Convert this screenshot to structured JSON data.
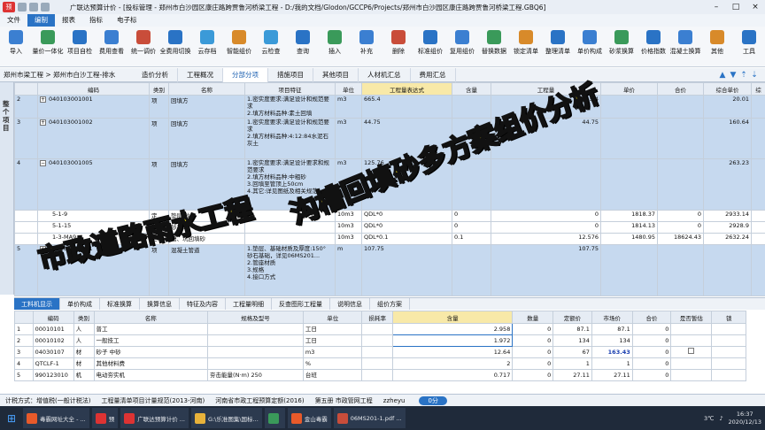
{
  "window": {
    "title": "广联达预算计价 - [投标管理 - 郑州市白沙园区康庄路跨贾鲁河桥梁工程 - D:/我的文档/Glodon/GCCP6/Projects/郑州市白沙园区康庄路跨贾鲁河桥梁工程.GBQ6]",
    "logo_text": "预"
  },
  "menu": [
    "文件",
    "编制",
    "报表",
    "指标",
    "电子标"
  ],
  "toolbar": [
    {
      "label": "导入",
      "color": "#3b7fd1"
    },
    {
      "label": "量价一体化",
      "color": "#3a9a5a"
    },
    {
      "label": "项目自检",
      "color": "#2a73c5"
    },
    {
      "label": "费用查看",
      "color": "#3b7fd1"
    },
    {
      "label": "统一调价",
      "color": "#c94d3a"
    },
    {
      "label": "全费用切换",
      "color": "#2a73c5"
    },
    {
      "label": "云存档",
      "color": "#3b9ad8"
    },
    {
      "label": "智能组价",
      "color": "#d88a2a"
    },
    {
      "label": "云检查",
      "color": "#3b9ad8"
    },
    {
      "label": "查询",
      "color": "#2a73c5"
    },
    {
      "label": "插入",
      "color": "#3a9a5a"
    },
    {
      "label": "补充",
      "color": "#3b7fd1"
    },
    {
      "label": "删除",
      "color": "#c94d3a"
    },
    {
      "label": "标准组价",
      "color": "#2a73c5"
    },
    {
      "label": "复用组价",
      "color": "#3b7fd1"
    },
    {
      "label": "替换数据",
      "color": "#3a9a5a"
    },
    {
      "label": "锁定清单",
      "color": "#d88a2a"
    },
    {
      "label": "整理清单",
      "color": "#2a73c5"
    },
    {
      "label": "单价构成",
      "color": "#3b7fd1"
    },
    {
      "label": "砂浆换算",
      "color": "#3a9a5a"
    },
    {
      "label": "价格指数",
      "color": "#2a73c5"
    },
    {
      "label": "混凝土换算",
      "color": "#3b7fd1"
    },
    {
      "label": "其他",
      "color": "#d88a2a"
    },
    {
      "label": "工具",
      "color": "#2a73c5"
    }
  ],
  "nav": {
    "breadcrumb": "郑州市梁工程 > 郑州市白沙工程-排水",
    "tabs": [
      "造价分析",
      "工程概况",
      "分部分项",
      "措施项目",
      "其他项目",
      "人材机汇总",
      "费用汇总"
    ],
    "selected": 2
  },
  "sidebar": {
    "label": "整个项目"
  },
  "upper": {
    "headers": [
      "编码",
      "类别",
      "名称",
      "项目特征",
      "单位",
      "工程量表达式",
      "含量",
      "工程量",
      "单价",
      "合价",
      "综合单价",
      "综"
    ],
    "rows": [
      {
        "no": "2",
        "code": "040103001001",
        "type": "项",
        "name": "回填方",
        "feature": "1.密实度要求:满足设计和规范要求\n2.填方材料品种:素土回填",
        "unit": "m3",
        "expr": "665.4",
        "content": "",
        "qty": "665.4",
        "price": "",
        "total": "",
        "unit_total": "20.01"
      },
      {
        "no": "3",
        "code": "040103001002",
        "type": "项",
        "name": "回填方",
        "feature": "1.密实度要求:满足设计和规范要求\n2.填方材料品种:4:12:84水泥石灰土",
        "unit": "m3",
        "expr": "44.75",
        "content": "",
        "qty": "44.75",
        "price": "",
        "total": "",
        "unit_total": "160.64"
      },
      {
        "no": "4",
        "code": "040103001005",
        "type": "项",
        "name": "回填方",
        "feature": "1.密实度要求:满足设计要求和规范要求\n2.填方材料品种:中粗砂\n3.回填至管顶上50cm\n4.其它:详见图纸及相关规范",
        "unit": "m3",
        "expr": "125.76",
        "content": "",
        "qty": "",
        "price": "",
        "total": "",
        "unit_total": "263.23"
      },
      {
        "no": "",
        "code": "5-1-9",
        "type": "定",
        "name": "垫层 砂",
        "feature": "",
        "unit": "10m3",
        "expr": "QDL*0",
        "content": "0",
        "qty": "0",
        "price": "1818.37",
        "total": "0",
        "unit_total": "2933.14"
      },
      {
        "no": "",
        "code": "5-1-15",
        "type": "定",
        "name": "砂基础",
        "feature": "",
        "unit": "10m3",
        "expr": "QDL*0",
        "content": "0",
        "qty": "0",
        "price": "1814.13",
        "total": "0",
        "unit_total": "2928.9"
      },
      {
        "no": "",
        "code": "1-3-MA9",
        "type": "定",
        "name": "槽、坑回填砂",
        "feature": "",
        "unit": "10m3",
        "expr": "QDL*0.1",
        "content": "0.1",
        "qty": "12.576",
        "price": "1480.95",
        "total": "18624.43",
        "unit_total": "2632.24"
      },
      {
        "no": "5",
        "code": "040501001001",
        "type": "项",
        "name": "混凝土管道",
        "feature": "1.垫层、基础材质及厚度:150° 砂石基础，详见06MS201...\n2.管座材质\n3.规格\n4.接口方式",
        "unit": "m",
        "expr": "107.75",
        "content": "",
        "qty": "107.75",
        "price": "",
        "total": "",
        "unit_total": ""
      }
    ]
  },
  "panel_tabs": [
    "工料机显示",
    "单价构成",
    "标准换算",
    "换算信息",
    "特征及内容",
    "工程量明细",
    "反查图形工程量",
    "说明信息",
    "组价方案"
  ],
  "lower": {
    "headers": [
      "编码",
      "类别",
      "名称",
      "规格及型号",
      "单位",
      "损耗率",
      "含量",
      "数量",
      "定额价",
      "市场价",
      "合价",
      "是否暂估",
      "锁"
    ],
    "rows": [
      {
        "code": "00010101",
        "type": "人",
        "name": "普工",
        "spec": "",
        "unit": "工日",
        "loss": "",
        "content": "2.958",
        "qty": "0",
        "base": "87.1",
        "market": "87.1",
        "total": "0",
        "est": false
      },
      {
        "code": "00010102",
        "type": "人",
        "name": "一般技工",
        "spec": "",
        "unit": "工日",
        "loss": "",
        "content": "1.972",
        "qty": "0",
        "base": "134",
        "market": "134",
        "total": "0",
        "est": false
      },
      {
        "code": "04030107",
        "type": "材",
        "name": "砂子 中砂",
        "spec": "",
        "unit": "m3",
        "loss": "",
        "content": "12.64",
        "qty": "0",
        "base": "67",
        "market": "163.43",
        "total": "0",
        "est": true
      },
      {
        "code": "QTCLF-1",
        "type": "材",
        "name": "其他材料费",
        "spec": "",
        "unit": "%",
        "loss": "",
        "content": "2",
        "qty": "0",
        "base": "1",
        "market": "1",
        "total": "0",
        "est": false
      },
      {
        "code": "990123010",
        "type": "机",
        "name": "电动夯实机",
        "spec": "夯击能量(N·m) 250",
        "unit": "台班",
        "loss": "",
        "content": "0.717",
        "qty": "0",
        "base": "27.11",
        "market": "27.11",
        "total": "0",
        "est": false
      }
    ]
  },
  "status": {
    "items": [
      "计税方式：增值税(一般计税法)",
      "工程量清单项目计量规范(2013-河南)",
      "河南省市政工程预算定额(2016)",
      "第五册 市政管网工程",
      "zzheyu"
    ],
    "pill": "0分"
  },
  "taskbar": {
    "apps": [
      {
        "label": "毒霸网址大全 - ...",
        "color": "#e85a2a"
      },
      {
        "label": "预",
        "color": "#d33"
      },
      {
        "label": "广联达预算计价 ...",
        "color": "#d33"
      },
      {
        "label": "G:\\乐准图集\\国标...",
        "color": "#e8b23a"
      },
      {
        "label": "",
        "color": "#3a9a5a"
      },
      {
        "label": "金山毒霸",
        "color": "#e85a2a"
      },
      {
        "label": "06MS201-1.pdf ...",
        "color": "#c94d3a"
      }
    ],
    "weather": "3℃",
    "time": "16:37",
    "date": "2020/12/13"
  },
  "overlays": {
    "line1": "市政道路雨水工程",
    "line2": "沟槽回填砂多方案组价分析"
  }
}
